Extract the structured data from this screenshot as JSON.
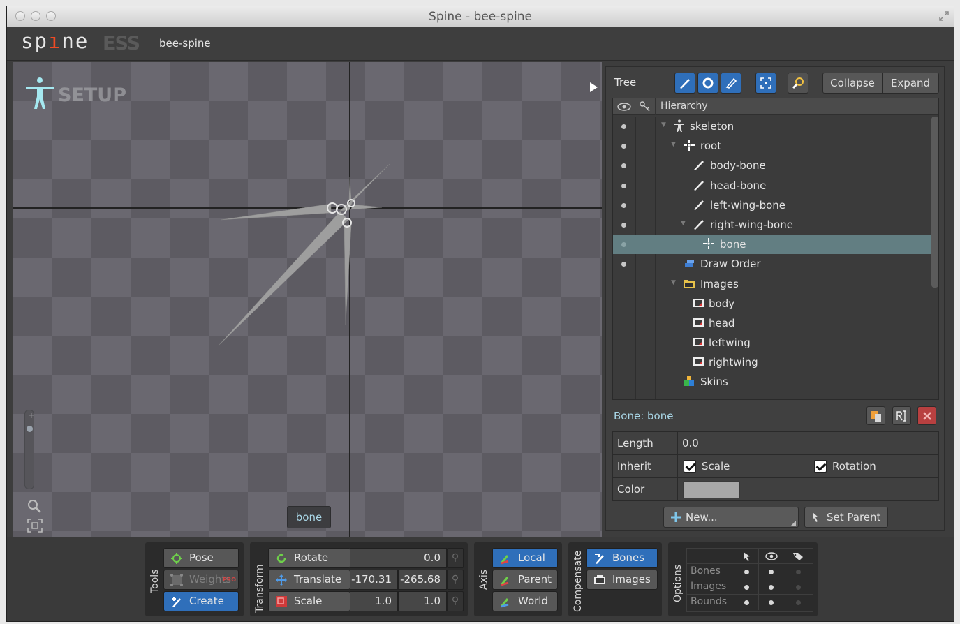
{
  "window": {
    "title": "Spine - bee-spine"
  },
  "app": {
    "logo_text_pre": "sp",
    "logo_text_i": "ı",
    "logo_text_post": "ne",
    "edition": "ESS",
    "project_name": "bee-spine"
  },
  "viewport": {
    "mode_label": "SETUP",
    "selected_bone_label": "bone",
    "zoom_plus": "+",
    "zoom_minus": "-"
  },
  "tree": {
    "label": "Tree",
    "collapse": "Collapse",
    "expand": "Expand",
    "header": "Hierarchy",
    "rows": [
      {
        "label": "skeleton",
        "icon": "skeleton-icon"
      },
      {
        "label": "root",
        "icon": "root-bone-icon"
      },
      {
        "label": "body-bone",
        "icon": "bone-icon"
      },
      {
        "label": "head-bone",
        "icon": "bone-icon"
      },
      {
        "label": "left-wing-bone",
        "icon": "bone-icon"
      },
      {
        "label": "right-wing-bone",
        "icon": "bone-icon"
      },
      {
        "label": "bone",
        "icon": "root-bone-icon",
        "selected": true
      },
      {
        "label": "Draw Order",
        "icon": "draw-order-icon"
      },
      {
        "label": "Images",
        "icon": "folder-icon"
      },
      {
        "label": "body",
        "icon": "image-icon"
      },
      {
        "label": "head",
        "icon": "image-icon"
      },
      {
        "label": "leftwing",
        "icon": "image-icon"
      },
      {
        "label": "rightwing",
        "icon": "image-icon"
      },
      {
        "label": "Skins",
        "icon": "skins-icon"
      }
    ]
  },
  "bone_props": {
    "title": "Bone: bone",
    "length_label": "Length",
    "length_value": "0.0",
    "inherit_label": "Inherit",
    "inherit_scale": "Scale",
    "inherit_rotation": "Rotation",
    "color_label": "Color",
    "new_button": "New...",
    "set_parent_button": "Set Parent"
  },
  "tools": {
    "label": "Tools",
    "pose": "Pose",
    "weights": "Weights",
    "weights_badge": "PRO",
    "create": "Create"
  },
  "transform": {
    "label": "Transform",
    "rotate": "Rotate",
    "rotate_value": "0.0",
    "translate": "Translate",
    "translate_x": "-170.31",
    "translate_y": "-265.68",
    "scale": "Scale",
    "scale_x": "1.0",
    "scale_y": "1.0"
  },
  "axis": {
    "label": "Axis",
    "local": "Local",
    "parent": "Parent",
    "world": "World"
  },
  "compensate": {
    "label": "Compensate",
    "bones": "Bones",
    "images": "Images"
  },
  "options": {
    "label": "Options",
    "rows": [
      "Bones",
      "Images",
      "Bounds"
    ]
  },
  "colors": {
    "accent_blue": "#2f6fba",
    "selection": "#627e82",
    "bone_label": "#a9d6e6",
    "logo_i": "#f04a24"
  }
}
